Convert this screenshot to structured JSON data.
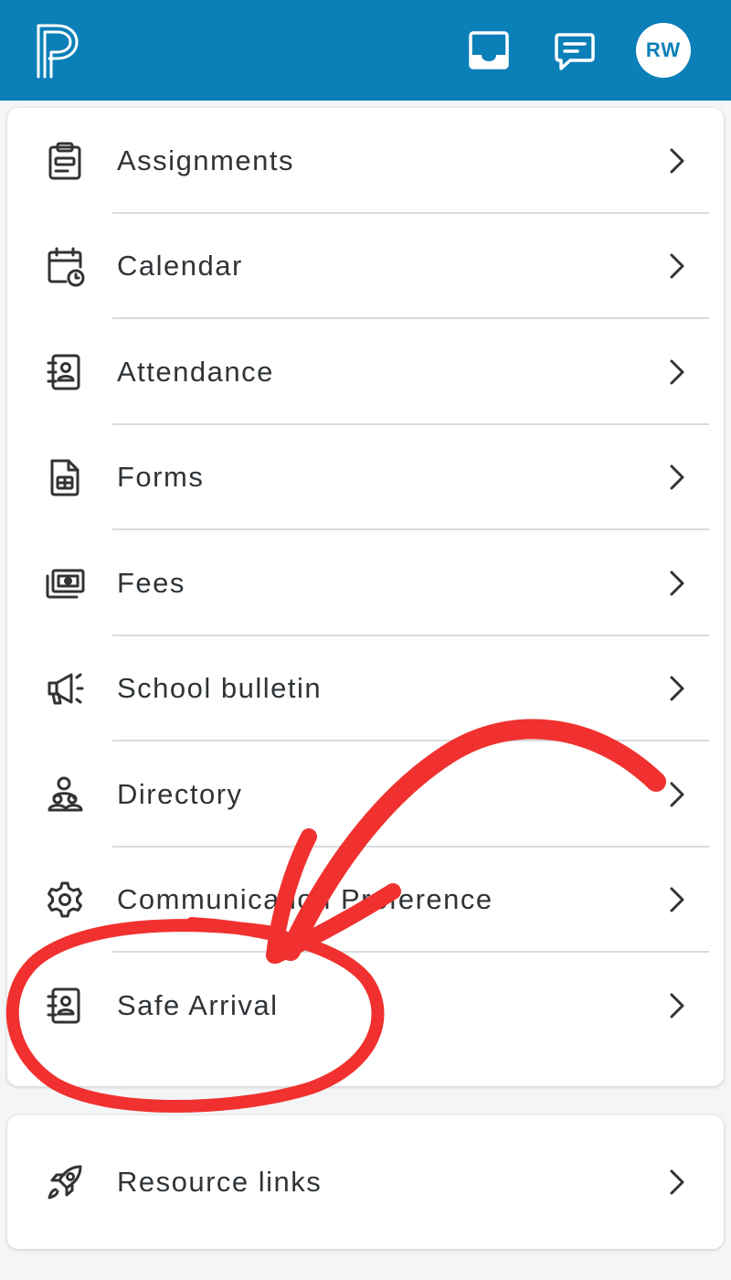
{
  "header": {
    "logo_icon": "powerschool-logo",
    "inbox_icon": "inbox-icon",
    "messages_icon": "chat-icon",
    "avatar_initials": "RW",
    "bar_color": "#0a7fb8"
  },
  "menu": {
    "items": [
      {
        "label": "Assignments",
        "icon": "clipboard-icon"
      },
      {
        "label": "Calendar",
        "icon": "calendar-clock-icon"
      },
      {
        "label": "Attendance",
        "icon": "contact-book-icon"
      },
      {
        "label": "Forms",
        "icon": "document-grid-icon"
      },
      {
        "label": "Fees",
        "icon": "money-icon"
      },
      {
        "label": "School bulletin",
        "icon": "megaphone-icon"
      },
      {
        "label": "Directory",
        "icon": "people-icon"
      },
      {
        "label": "Communication Preference",
        "icon": "gear-icon"
      },
      {
        "label": "Safe Arrival",
        "icon": "contact-book-icon"
      }
    ]
  },
  "resources": {
    "label": "Resource links",
    "icon": "rocket-icon"
  },
  "annotation": {
    "type": "red-arrow-and-circle",
    "color": "#f0312f"
  }
}
